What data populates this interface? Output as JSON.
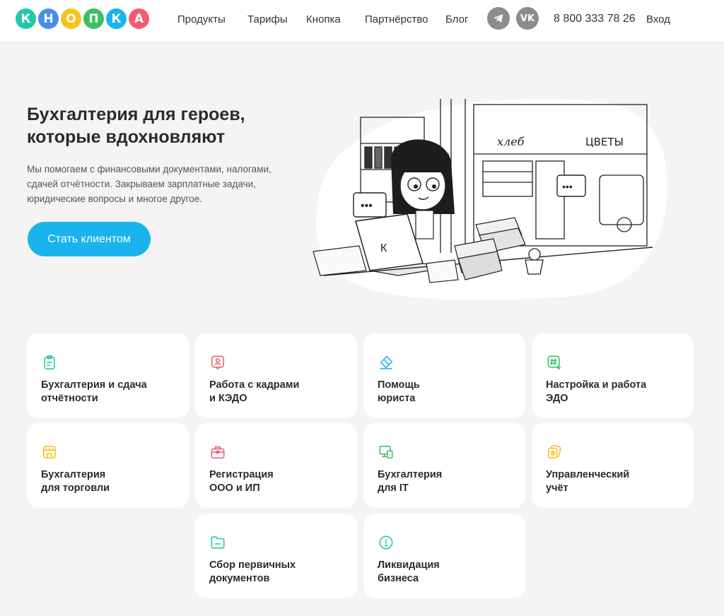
{
  "header": {
    "logo_letters": [
      {
        "ch": "К",
        "color": "#22c9a8"
      },
      {
        "ch": "Н",
        "color": "#4a8de8"
      },
      {
        "ch": "О",
        "color": "#f7c31b"
      },
      {
        "ch": "П",
        "color": "#3ac063"
      },
      {
        "ch": "К",
        "color": "#1ab3ee"
      },
      {
        "ch": "А",
        "color": "#f25b6e"
      }
    ],
    "nav": [
      "Продукты",
      "Тарифы",
      "Кнопка",
      "Партнёрство",
      "Блог"
    ],
    "social": [
      "telegram-icon",
      "vk-icon"
    ],
    "vk_label": "VK",
    "phone": "8 800 333 78 26",
    "login": "Вход"
  },
  "hero": {
    "title": "Бухгалтерия для героев, которые вдохновляют",
    "text": "Мы помогаем с финансовыми документами, налогами, сдачей отчётности. Закрываем зарплатные задачи, юридические вопросы и многое другое.",
    "cta": "Стать клиентом",
    "sign_bread": "хлеб",
    "sign_flowers": "ЦВЕТЫ",
    "laptop_letter": "К"
  },
  "colors": {
    "accent": "#1ab3ee",
    "background": "#f5f4f2"
  },
  "services": [
    {
      "title": "Бухгалтерия и сдача\nотчётности",
      "icon": "clipboard-icon",
      "color": "#22c9a8"
    },
    {
      "title": "Работа с кадрами\nи КЭДО",
      "icon": "user-document-icon",
      "color": "#f25b6e"
    },
    {
      "title": "Помощь\nюриста",
      "icon": "eraser-icon",
      "color": "#1ab3ee"
    },
    {
      "title": "Настройка и работа\nЭДО",
      "icon": "hashtag-download-icon",
      "color": "#3ac063"
    },
    {
      "title": "Бухгалтерия\nдля торговли",
      "icon": "shop-icon",
      "color": "#f7c31b"
    },
    {
      "title": "Регистрация\nООО и ИП",
      "icon": "briefcase-icon",
      "color": "#f25b6e"
    },
    {
      "title": "Бухгалтерия\nдля IT",
      "icon": "devices-icon",
      "color": "#3ac063"
    },
    {
      "title": "Управленческий\nучёт",
      "icon": "documents-icon",
      "color": "#f7c31b"
    },
    {
      "title": "Сбор первичных\nдокументов",
      "icon": "folder-icon",
      "color": "#22c9a8"
    },
    {
      "title": "Ликвидация\nбизнеса",
      "icon": "alert-circle-icon",
      "color": "#22c9a8"
    }
  ]
}
